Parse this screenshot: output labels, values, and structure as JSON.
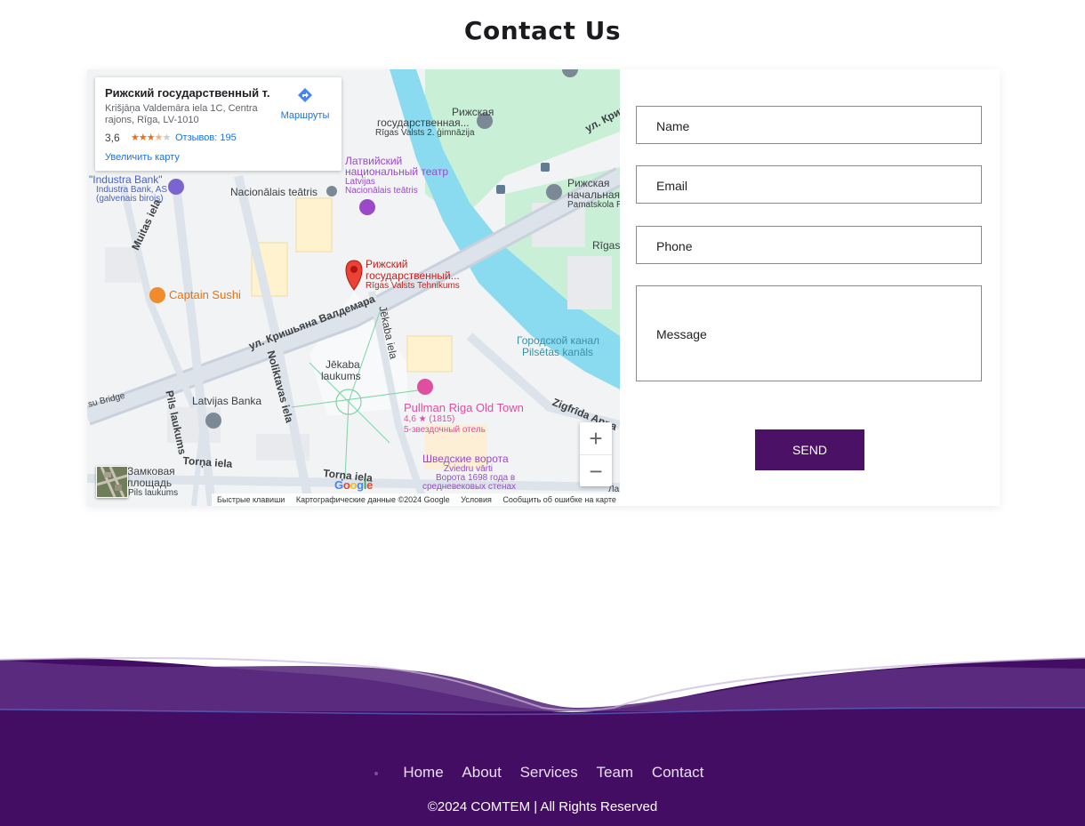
{
  "page": {
    "title": "Contact Us"
  },
  "map": {
    "place_card": {
      "name": "Рижский государственный т...",
      "address": "Krišjāņa Valdemāra iela 1C, Centra rajons, Rīga, LV-1010",
      "rating": "3,6",
      "stars_on": "★★★",
      "stars_half": "★",
      "stars_off": "★",
      "reviews": "Отзывов: 195",
      "directions_label": "Маршруты",
      "enlarge_label": "Увеличить карту"
    },
    "labels": {
      "riga_gymnasium_1": "Рижская",
      "riga_gymnasium_2": "государственная...",
      "riga_gymnasium_3": "Rīgas Valsts 2. ģimnāzija",
      "theatre_1": "Латвийский",
      "theatre_2": "национальный театр",
      "theatre_3": "Latvijas",
      "theatre_4": "Nacionālais teātris",
      "nacionalais_teatris": "Nacionālais teātris",
      "industra_1": "\"Industra Bank\"",
      "industra_2": "Industra Bank, AS",
      "industra_3": "(galvenais birojs)",
      "muitas": "Muitas iela",
      "captain_sushi": "Captain Sushi",
      "tech_1": "Рижский",
      "tech_2": "государственный...",
      "tech_3": "Rīgas Valsts Tehnikums",
      "kr_valdemara": "ул. Кришьяна Валдемара",
      "jekaba_iela": "Jēkaba iela",
      "canal_1": "Городской канал",
      "canal_2": "Pilsētas kanāls",
      "jekaba_1": "Jēkaba",
      "jekaba_2": "laukums",
      "latvijas_banka": "Latvijas Banka",
      "noliktavas": "Noliktavas iela",
      "pils_laukums": "Pils laukums",
      "pullman_1": "Pullman Riga Old Town",
      "pullman_2": "4,6 ★ (1815)",
      "pullman_3": "5-звездочный отель",
      "zigfrida": "Zigfrīda Anna",
      "swedish_1": "Шведские ворота",
      "swedish_2": "Zviedru vārti",
      "swedish_3": "Ворота 1698 года в",
      "swedish_4": "средневековых стенах",
      "torna_1": "Torņa iela",
      "torna_2": "Torņa iela",
      "castle_1": "Замковая",
      "castle_2": "площадь",
      "castle_3": "Pils laukums",
      "primary_school_1": "Рижская",
      "primary_school_2": "начальная",
      "primary_school_3": "Pamatskola R",
      "rigas": "Rīgas",
      "kr_top": "ул. Криш",
      "bridge": "su Bridge",
      "la": "Ла"
    },
    "zoom_in": "+",
    "zoom_out": "−",
    "google_logo": "Google",
    "footer": {
      "shortcuts": "Быстрые клавиши",
      "data": "Картографические данные ©2024 Google",
      "terms": "Условия",
      "report": "Сообщить об ошибке на карте"
    }
  },
  "form": {
    "name_placeholder": "Name",
    "email_placeholder": "Email",
    "phone_placeholder": "Phone",
    "message_placeholder": "Message",
    "send_label": "SEND"
  },
  "footer": {
    "nav": [
      "Home",
      "About",
      "Services",
      "Team",
      "Contact"
    ],
    "copyright": "©2024 COMTEM | All Rights Reserved"
  },
  "colors": {
    "brand_purple": "#4a1166",
    "footer_purple": "#420d63"
  }
}
